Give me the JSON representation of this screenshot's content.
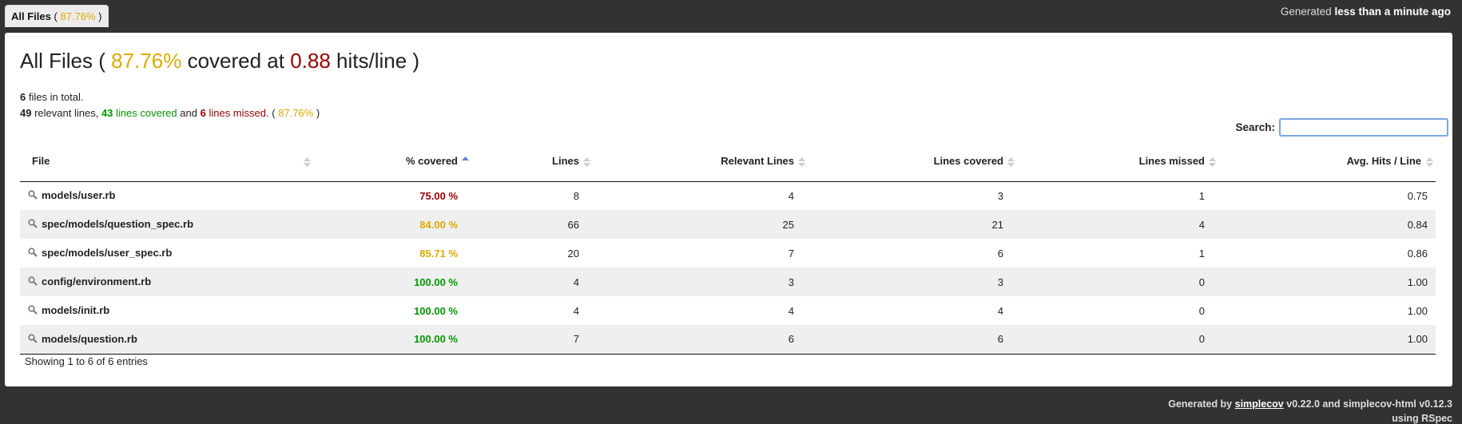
{
  "tab": {
    "label": "All Files",
    "percent": "87.76%"
  },
  "timestamp": {
    "prefix": "Generated",
    "value": "less than a minute ago"
  },
  "header": {
    "title_prefix": "All Files (",
    "percent": "87.76%",
    "covered_at": "covered at",
    "hits": "0.88",
    "title_suffix": "hits/line )"
  },
  "summary": {
    "files_count": "6",
    "files_text": "files in total.",
    "relevant": "49",
    "relevant_text": "relevant lines,",
    "covered": "43",
    "covered_text": "lines covered",
    "and_text": "and",
    "missed": "6",
    "missed_text": "lines missed.",
    "percent_open": "(",
    "percent": "87.76%",
    "percent_close": ")"
  },
  "search": {
    "label": "Search:",
    "value": "",
    "placeholder": ""
  },
  "columns": [
    "File",
    "% covered",
    "Lines",
    "Relevant Lines",
    "Lines covered",
    "Lines missed",
    "Avg. Hits / Line"
  ],
  "rows": [
    {
      "file": "models/user.rb",
      "covered": "75.00 %",
      "status": "red",
      "lines": "8",
      "relevant": "4",
      "lines_covered": "3",
      "missed": "1",
      "avg": "0.75"
    },
    {
      "file": "spec/models/question_spec.rb",
      "covered": "84.00 %",
      "status": "yellow",
      "lines": "66",
      "relevant": "25",
      "lines_covered": "21",
      "missed": "4",
      "avg": "0.84"
    },
    {
      "file": "spec/models/user_spec.rb",
      "covered": "85.71 %",
      "status": "yellow",
      "lines": "20",
      "relevant": "7",
      "lines_covered": "6",
      "missed": "1",
      "avg": "0.86"
    },
    {
      "file": "config/environment.rb",
      "covered": "100.00 %",
      "status": "green",
      "lines": "4",
      "relevant": "3",
      "lines_covered": "3",
      "missed": "0",
      "avg": "1.00"
    },
    {
      "file": "models/init.rb",
      "covered": "100.00 %",
      "status": "green",
      "lines": "4",
      "relevant": "4",
      "lines_covered": "4",
      "missed": "0",
      "avg": "1.00"
    },
    {
      "file": "models/question.rb",
      "covered": "100.00 %",
      "status": "green",
      "lines": "7",
      "relevant": "6",
      "lines_covered": "6",
      "missed": "0",
      "avg": "1.00"
    }
  ],
  "entries_info": "Showing 1 to 6 of 6 entries",
  "footer": {
    "generated_by": "Generated by",
    "link": "simplecov",
    "version_text": "v0.22.0 and simplecov-html v0.12.3",
    "line2": "using RSpec"
  },
  "colors": {
    "green": "#009900",
    "yellow": "#ddaa00",
    "red": "#990000",
    "background": "#323232"
  }
}
